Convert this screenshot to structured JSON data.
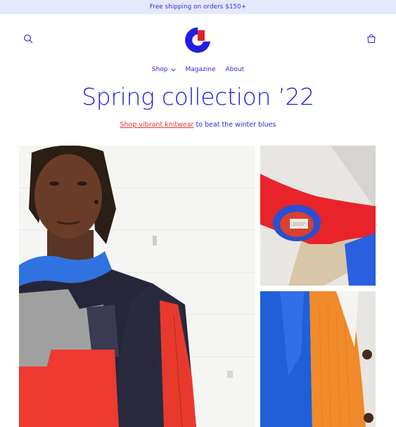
{
  "announcement": {
    "text": "Free shipping on orders $150+"
  },
  "header": {
    "search_icon": "search-icon",
    "cart_icon": "cart-icon",
    "logo_colors": {
      "blue": "#1f1fe0",
      "red": "#e8202a"
    }
  },
  "nav": {
    "items": [
      {
        "label": "Shop",
        "has_dropdown": true
      },
      {
        "label": "Magazine"
      },
      {
        "label": "About"
      }
    ]
  },
  "hero": {
    "title": "Spring collection ’22",
    "link_text": "Shop vibrant knitwear",
    "subtitle_rest": " to beat the winter blues"
  },
  "colors": {
    "accent": "#1f1fe0",
    "link": "#e0353a",
    "announcement_bg": "#e4e8fb"
  }
}
